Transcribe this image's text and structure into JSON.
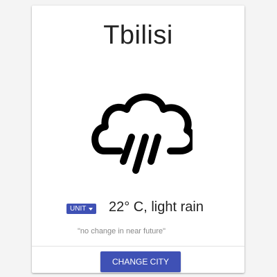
{
  "city": {
    "name": "Tbilisi"
  },
  "weather": {
    "icon": "rain-cloud-icon",
    "reading": "22° C, light rain",
    "forecast_note": "\"no change in near future\""
  },
  "controls": {
    "unit_label": "UNIT",
    "change_city_label": "CHANGE CITY"
  },
  "colors": {
    "accent": "#3f51b5",
    "text": "#222222",
    "muted_text": "#888888"
  }
}
